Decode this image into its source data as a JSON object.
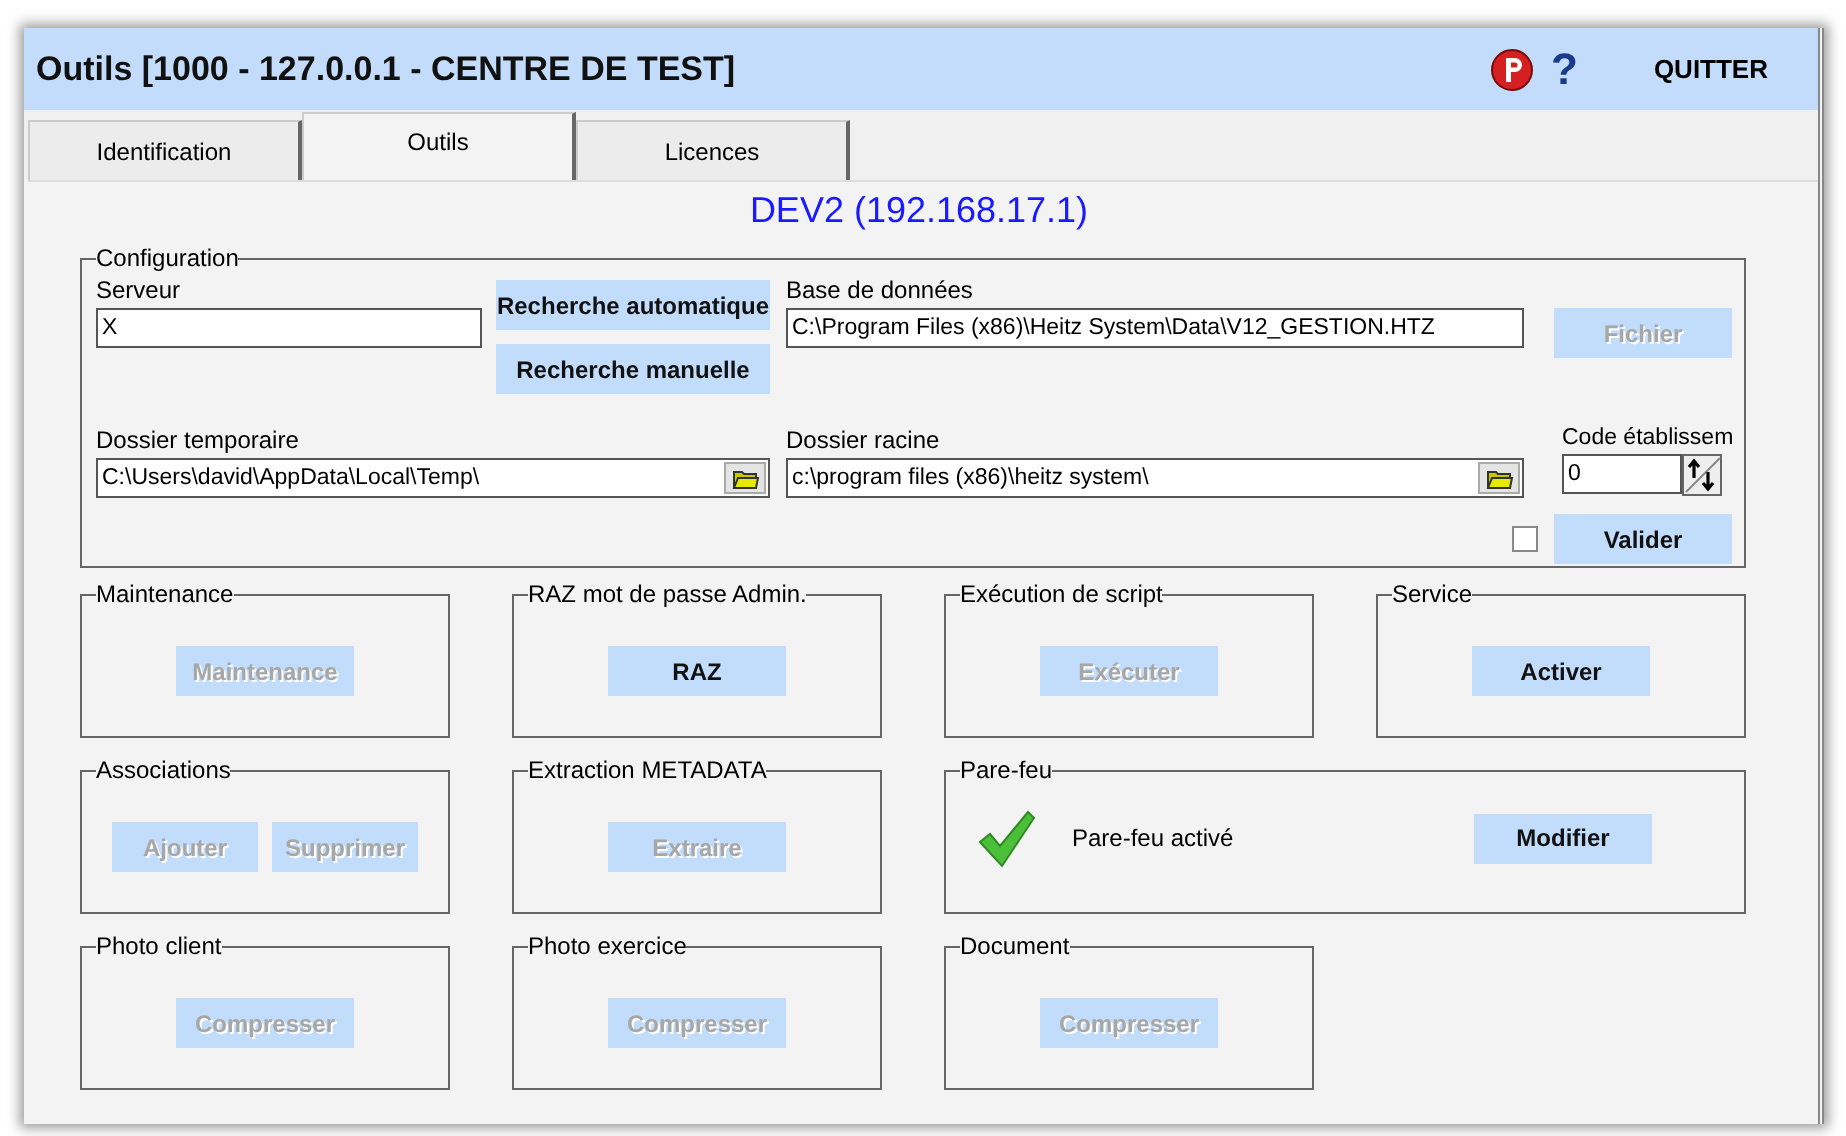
{
  "window": {
    "title": "Outils [1000 - 127.0.0.1 - CENTRE DE TEST]",
    "help": "?",
    "quit": "QUITTER"
  },
  "tabs": [
    {
      "label": "Identification",
      "selected": false
    },
    {
      "label": "Outils",
      "selected": true
    },
    {
      "label": "Licences",
      "selected": false
    }
  ],
  "server_heading": "DEV2 (192.168.17.1)",
  "configuration": {
    "title": "Configuration",
    "server": {
      "label": "Serveur",
      "value": "X"
    },
    "search_buttons": [
      {
        "label": "Recherche automatique",
        "disabled": false
      },
      {
        "label": "Recherche manuelle",
        "disabled": false
      }
    ],
    "database": {
      "label": "Base de données",
      "value": "C:\\Program Files (x86)\\Heitz System\\Data\\V12_GESTION.HTZ"
    },
    "file_button": {
      "label": "Fichier",
      "disabled": true
    },
    "temp_folder": {
      "label": "Dossier temporaire",
      "value": "C:\\Users\\david\\AppData\\Local\\Temp\\"
    },
    "root_folder": {
      "label": "Dossier racine",
      "value": "c:\\program files (x86)\\heitz system\\"
    },
    "code": {
      "label": "Code établissem",
      "value": "0"
    },
    "checkbox": {
      "checked": false
    },
    "validate_button": {
      "label": "Valider",
      "disabled": false
    }
  },
  "groups": [
    {
      "title": "Maintenance",
      "kind": "buttons",
      "buttons": [
        {
          "label": "Maintenance",
          "disabled": true
        }
      ]
    },
    {
      "title": "RAZ mot de passe Admin.",
      "kind": "buttons",
      "buttons": [
        {
          "label": "RAZ",
          "disabled": false
        }
      ]
    },
    {
      "title": "Exécution de script",
      "kind": "buttons",
      "buttons": [
        {
          "label": "Exécuter",
          "disabled": true
        }
      ]
    },
    {
      "title": "Service",
      "kind": "buttons",
      "buttons": [
        {
          "label": "Activer",
          "disabled": false
        }
      ]
    },
    {
      "title": "Associations",
      "kind": "buttons",
      "buttons": [
        {
          "label": "Ajouter",
          "disabled": true
        },
        {
          "label": "Supprimer",
          "disabled": true
        }
      ]
    },
    {
      "title": "Extraction METADATA",
      "kind": "buttons",
      "buttons": [
        {
          "label": "Extraire",
          "disabled": true
        }
      ]
    },
    {
      "title": "Pare-feu",
      "kind": "status",
      "active": true,
      "status": "Pare-feu activé",
      "buttons": [
        {
          "label": "Modifier",
          "disabled": false
        }
      ]
    },
    {
      "title": "Photo client",
      "kind": "buttons",
      "buttons": [
        {
          "label": "Compresser",
          "disabled": true
        }
      ]
    },
    {
      "title": "Photo exercice",
      "kind": "buttons",
      "buttons": [
        {
          "label": "Compresser",
          "disabled": true
        }
      ]
    },
    {
      "title": "Document",
      "kind": "buttons",
      "buttons": [
        {
          "label": "Compresser",
          "disabled": true
        }
      ]
    }
  ]
}
